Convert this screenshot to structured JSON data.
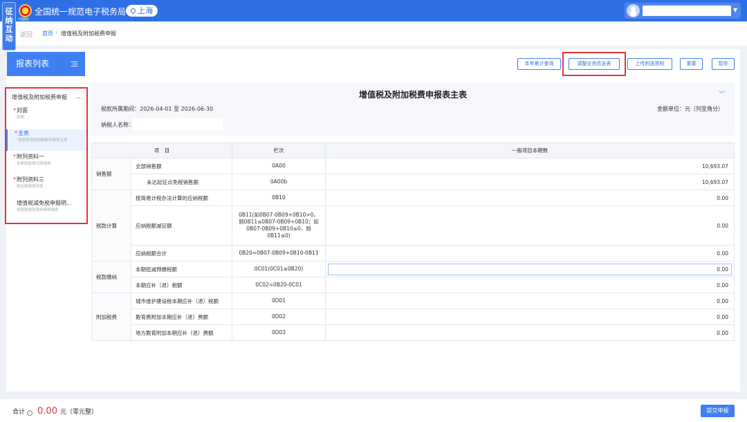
{
  "app": {
    "side_tag": "征纳互动",
    "title": "全国统一规范电子税务局",
    "emblem_text": "中国税务",
    "region": "上海"
  },
  "breadcrumb": {
    "back": "返回",
    "home": "首页",
    "separator": "›",
    "current": "增值税及附加税费申报"
  },
  "sidebar": {
    "header": "报表列表",
    "group": "增值税及附加税费申报",
    "items": [
      {
        "title": "封面",
        "subtitle": "封面",
        "required": "*"
      },
      {
        "title": "主表",
        "subtitle": "增值税及附加税费申报表主表",
        "required": "*"
      },
      {
        "title": "附列资料一",
        "subtitle": "本期销售情况明细表",
        "required": "*"
      },
      {
        "title": "附列资料三",
        "subtitle": "附加税费情况表",
        "required": "*"
      },
      {
        "title": "增值税减免税申报明...",
        "subtitle": "增值税减免税申报明细表",
        "required": ""
      }
    ]
  },
  "toolbar": {
    "buttons": [
      "本年累计查询",
      "调整业务信息表",
      "上传附送资料",
      "重置",
      "暂存"
    ]
  },
  "form": {
    "title": "增值税及附加税费申报表主表",
    "period": "税款所属期间：2026-04-01 至 2026-06-30",
    "unit": "金额单位：元（列至角分）",
    "taxpayer_label": "纳税人名称："
  },
  "table": {
    "headers": [
      "项　目",
      "栏次",
      "一般项目本期数"
    ],
    "categories": [
      "销售额",
      "税款计算",
      "税款缴纳",
      "附加税费"
    ],
    "rows": [
      {
        "item": "全部销售额",
        "code": "0A00",
        "value": "10,693.07"
      },
      {
        "item": "未达起征点免税销售额",
        "code": "0A00b",
        "value": "10,693.07"
      },
      {
        "item": "按简易计税办法计算的应纳税额",
        "code": "0B10",
        "value": "0.00"
      },
      {
        "item": "应纳税额减征额",
        "code": "0B11(如0B07-0B09+0B10>0，则0B11≤0B07-0B09+0B10；如0B07-0B09+0B10≤0，则0B11≤0)",
        "value": "0.00"
      },
      {
        "item": "应纳税额合计",
        "code": "0B20=0B07-0B09+0B10-0B11",
        "value": "0.00"
      },
      {
        "item": "本期抵减预缴税额",
        "code": "0C01(0C01≤0B20)",
        "value": "0.00"
      },
      {
        "item": "本期应补（退）税额",
        "code": "0C02=0B20-0C01",
        "value": "0.00"
      },
      {
        "item": "城市维护建设税本期应补（退）税额",
        "code": "0D01",
        "value": "0.00"
      },
      {
        "item": "教育费附加本期应补（退）费额",
        "code": "0D02",
        "value": "0.00"
      },
      {
        "item": "地方教育附加本期应补（退）费额",
        "code": "0D03",
        "value": "0.00"
      }
    ]
  },
  "footer": {
    "total_label": "合计",
    "info_icon": "i",
    "amount": "0.00",
    "currency": "元（零元整）",
    "submit": "提交申报"
  },
  "colors": {
    "primary": "#2f6fe6",
    "highlight": "#e3323a"
  }
}
